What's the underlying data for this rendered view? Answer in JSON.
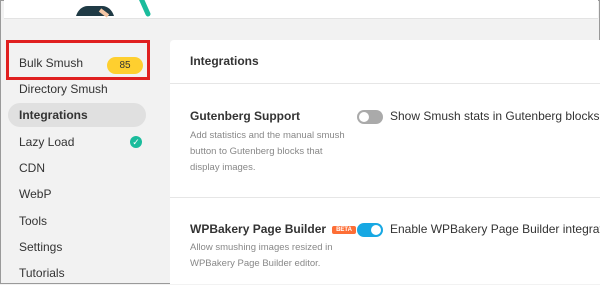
{
  "sidebar": {
    "items": [
      {
        "label": "Bulk Smush",
        "badge": "85"
      },
      {
        "label": "Directory Smush"
      },
      {
        "label": "Integrations"
      },
      {
        "label": "Lazy Load",
        "status_icon": "check-icon"
      },
      {
        "label": "CDN"
      },
      {
        "label": "WebP"
      },
      {
        "label": "Tools"
      },
      {
        "label": "Settings"
      },
      {
        "label": "Tutorials"
      }
    ],
    "active": "Integrations"
  },
  "panel": {
    "title": "Integrations",
    "rows": [
      {
        "title": "Gutenberg Support",
        "description": "Add statistics and the manual smush button to Gutenberg blocks that display images.",
        "toggle_label": "Show Smush stats in Gutenberg blocks",
        "toggle_on": false
      },
      {
        "title": "WPBakery Page Builder",
        "tag": "BETA",
        "description": "Allow smushing images resized in WPBakery Page Builder editor.",
        "toggle_label": "Enable WPBakery Page Builder integration",
        "toggle_on": true
      }
    ]
  },
  "colors": {
    "badge": "#fecf2f",
    "check": "#1abc9c",
    "toggle_on": "#17a8e3",
    "beta": "#fd6e36",
    "highlight": "#e02020"
  }
}
